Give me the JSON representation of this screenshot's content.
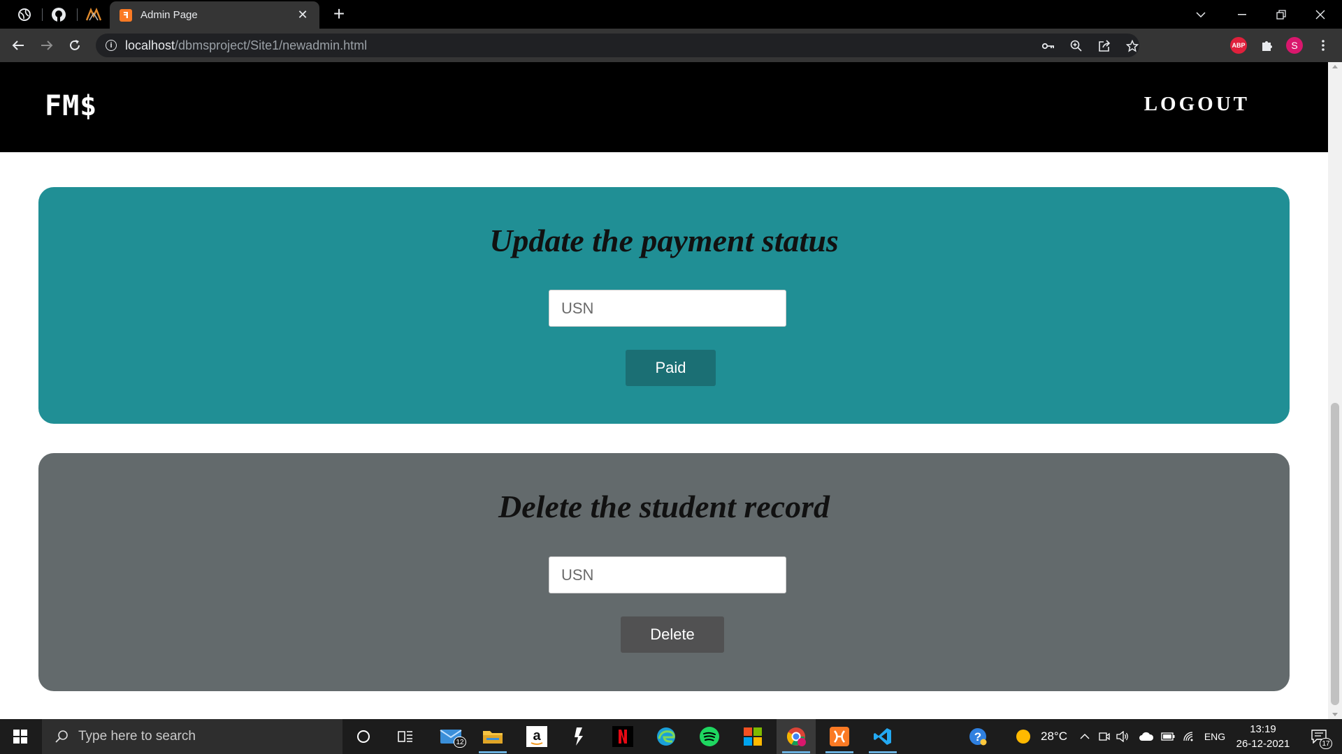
{
  "browser": {
    "tab_title": "Admin Page",
    "tab_favicon_glyph": "ꟻ",
    "new_tab": "+",
    "url_host": "localhost",
    "url_path": "/dbmsproject/Site1/newadmin.html",
    "profile_initial": "S",
    "abp_label": "ABP"
  },
  "site": {
    "logo": "FM$",
    "logout": "LOGOUT"
  },
  "payment": {
    "title": "Update the payment status",
    "input_placeholder": "USN",
    "button": "Paid",
    "bg_color": "#208f95"
  },
  "delete": {
    "title": "Delete the student record",
    "input_placeholder": "USN",
    "button": "Delete",
    "bg_color": "#636a6c"
  },
  "taskbar": {
    "search_placeholder": "Type here to search",
    "mail_badge": "12",
    "weather": "28°C",
    "language": "ENG",
    "time": "13:19",
    "date": "26-12-2021",
    "notification_badge": "17"
  }
}
